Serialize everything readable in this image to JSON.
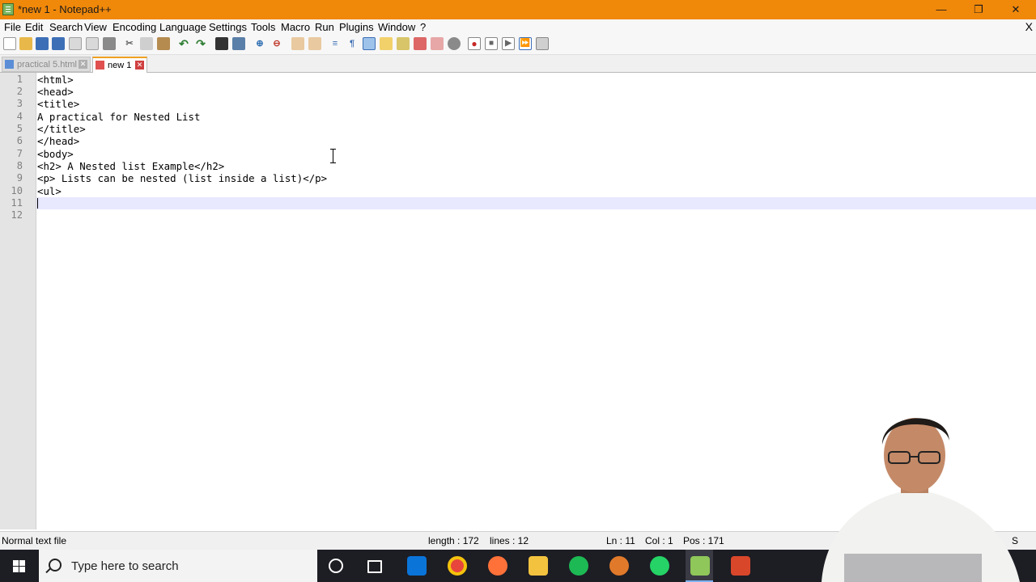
{
  "window": {
    "title": "*new 1 - Notepad++",
    "minimize": "—",
    "maximize": "❐",
    "close": "✕"
  },
  "menu": [
    "File",
    "Edit",
    "Search",
    "View",
    "Encoding",
    "Language",
    "Settings",
    "Tools",
    "Macro",
    "Run",
    "Plugins",
    "Window",
    "?"
  ],
  "menu_close": "X",
  "tabs": [
    {
      "label": "practical 5.html",
      "active": false
    },
    {
      "label": "new 1",
      "active": true
    }
  ],
  "editor": {
    "line_numbers": [
      "1",
      "2",
      "3",
      "4",
      "5",
      "6",
      "7",
      "8",
      "9",
      "10",
      "11",
      "12"
    ],
    "lines": [
      "<html>",
      "<head>",
      "<title>",
      "A practical for Nested List",
      "</title>",
      "</head>",
      "<body>",
      "<h2> A Nested list Example</h2>",
      "<p> Lists can be nested (list inside a list)</p>",
      "<ul>",
      "",
      ""
    ],
    "current_line": 11
  },
  "status": {
    "file_type": "Normal text file",
    "length": "length : 172",
    "lines": "lines : 12",
    "ln": "Ln : 11",
    "col": "Col : 1",
    "pos": "Pos : 171",
    "trailing": "S"
  },
  "taskbar": {
    "search_placeholder": "Type here to search",
    "apps": [
      "cortana-icon",
      "task-view-icon",
      "mail-icon",
      "chrome-icon",
      "firefox-icon",
      "file-explorer-icon",
      "spotify-icon",
      "paint-icon",
      "whatsapp-icon",
      "notepadpp-icon",
      "presentation-icon"
    ]
  },
  "colors": {
    "titlebar": "#f0880a",
    "current_line": "#e8e8ff",
    "gutter": "#e4e4e4",
    "taskbar": "#1d1d24"
  }
}
